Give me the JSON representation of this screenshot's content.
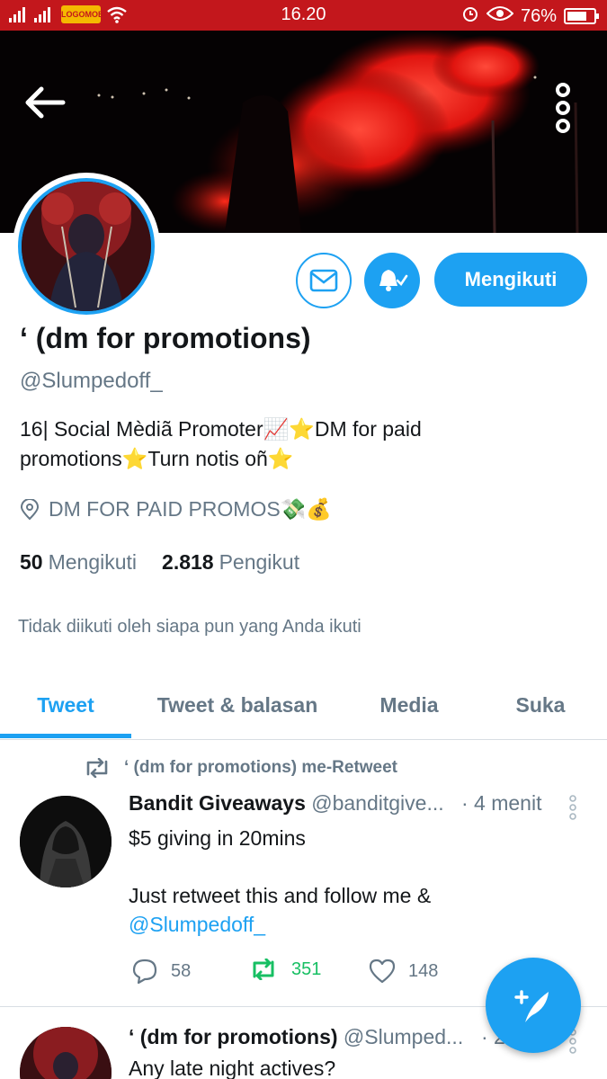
{
  "status_bar": {
    "carrier_badge": "LOGOMOBI",
    "time": "16.20",
    "battery": "76%",
    "battery_level": 0.76
  },
  "profile": {
    "name": "‘ (dm for promotions)",
    "handle": "@Slumpedoff_",
    "bio_line1": "16| Social Mèdiã Promoter📈⭐DM for paid",
    "bio_line2": "promotions⭐Turn notis oñ⭐",
    "location": "DM FOR PAID PROMOS💸💰",
    "following_count": "50",
    "following_label": "Mengikuti",
    "followers_count": "2.818",
    "followers_label": "Pengikut",
    "not_followed_text": "Tidak diikuti oleh siapa pun yang Anda ikuti",
    "follow_button": "Mengikuti"
  },
  "icons": {
    "back": "arrow-left-icon",
    "more": "more-vertical-icon",
    "message": "envelope-icon",
    "notifications": "bell-check-icon",
    "location": "location-pin-icon",
    "retweet": "retweet-icon",
    "reply": "reply-icon",
    "like": "heart-icon",
    "compose": "compose-feather-icon"
  },
  "colors": {
    "accent": "#1da1f2",
    "status_bar": "#c3171c",
    "retweet_green": "#17bf63",
    "muted": "#657786"
  },
  "tabs": [
    {
      "label": "Tweet",
      "active": true
    },
    {
      "label": "Tweet & balasan",
      "active": false
    },
    {
      "label": "Media",
      "active": false
    },
    {
      "label": "Suka",
      "active": false
    }
  ],
  "tweets": [
    {
      "retweet_note": "‘ (dm for promotions) me-Retweet",
      "author_name": "Bandit Giveaways",
      "author_handle": "@banditgive...",
      "time": "· 4 menit",
      "line1": "$5 giving in 20mins",
      "line2": "Just retweet this and follow me &",
      "mention": "@Slumpedoff_",
      "replies": "58",
      "retweets": "351",
      "likes": "148"
    },
    {
      "author_name": "‘ (dm for promotions)",
      "author_handle": "@Slumped...",
      "time": "· 2",
      "line1": "Any late night actives?"
    }
  ]
}
